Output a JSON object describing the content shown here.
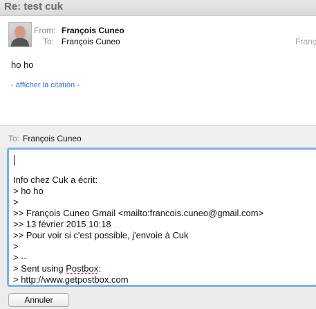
{
  "window": {
    "title": "Re: test cuk"
  },
  "message": {
    "from_label": "From:",
    "from_value": "François Cuneo",
    "to_label": "To:",
    "to_value": "François Cuneo",
    "date_fragment": "Franç",
    "body": "ho ho",
    "show_quote_link": "- afficher la citation -"
  },
  "reply": {
    "to_label": "To:",
    "to_value": "François Cuneo",
    "lines": [
      "Info chez Cuk a écrit:",
      "> ho ho",
      ">",
      ">> François Cuneo Gmail <mailto:francois.cuneo@gmail.com>",
      ">> 13 février 2015 10:18",
      ">> Pour voir si c'est possible, j'envoie à Cuk",
      ">",
      "> --",
      "> Sent using ",
      "> http://www.getpostbox.com"
    ],
    "misspelled_word": "Postbox",
    "misspelled_suffix": ":"
  },
  "actions": {
    "cancel_label": "Annuler"
  },
  "colors": {
    "editor_border": "#7eaeea",
    "link": "#3a6fd8",
    "spellcheck": "#d20000"
  },
  "icons": {
    "avatar": "sender-avatar"
  }
}
